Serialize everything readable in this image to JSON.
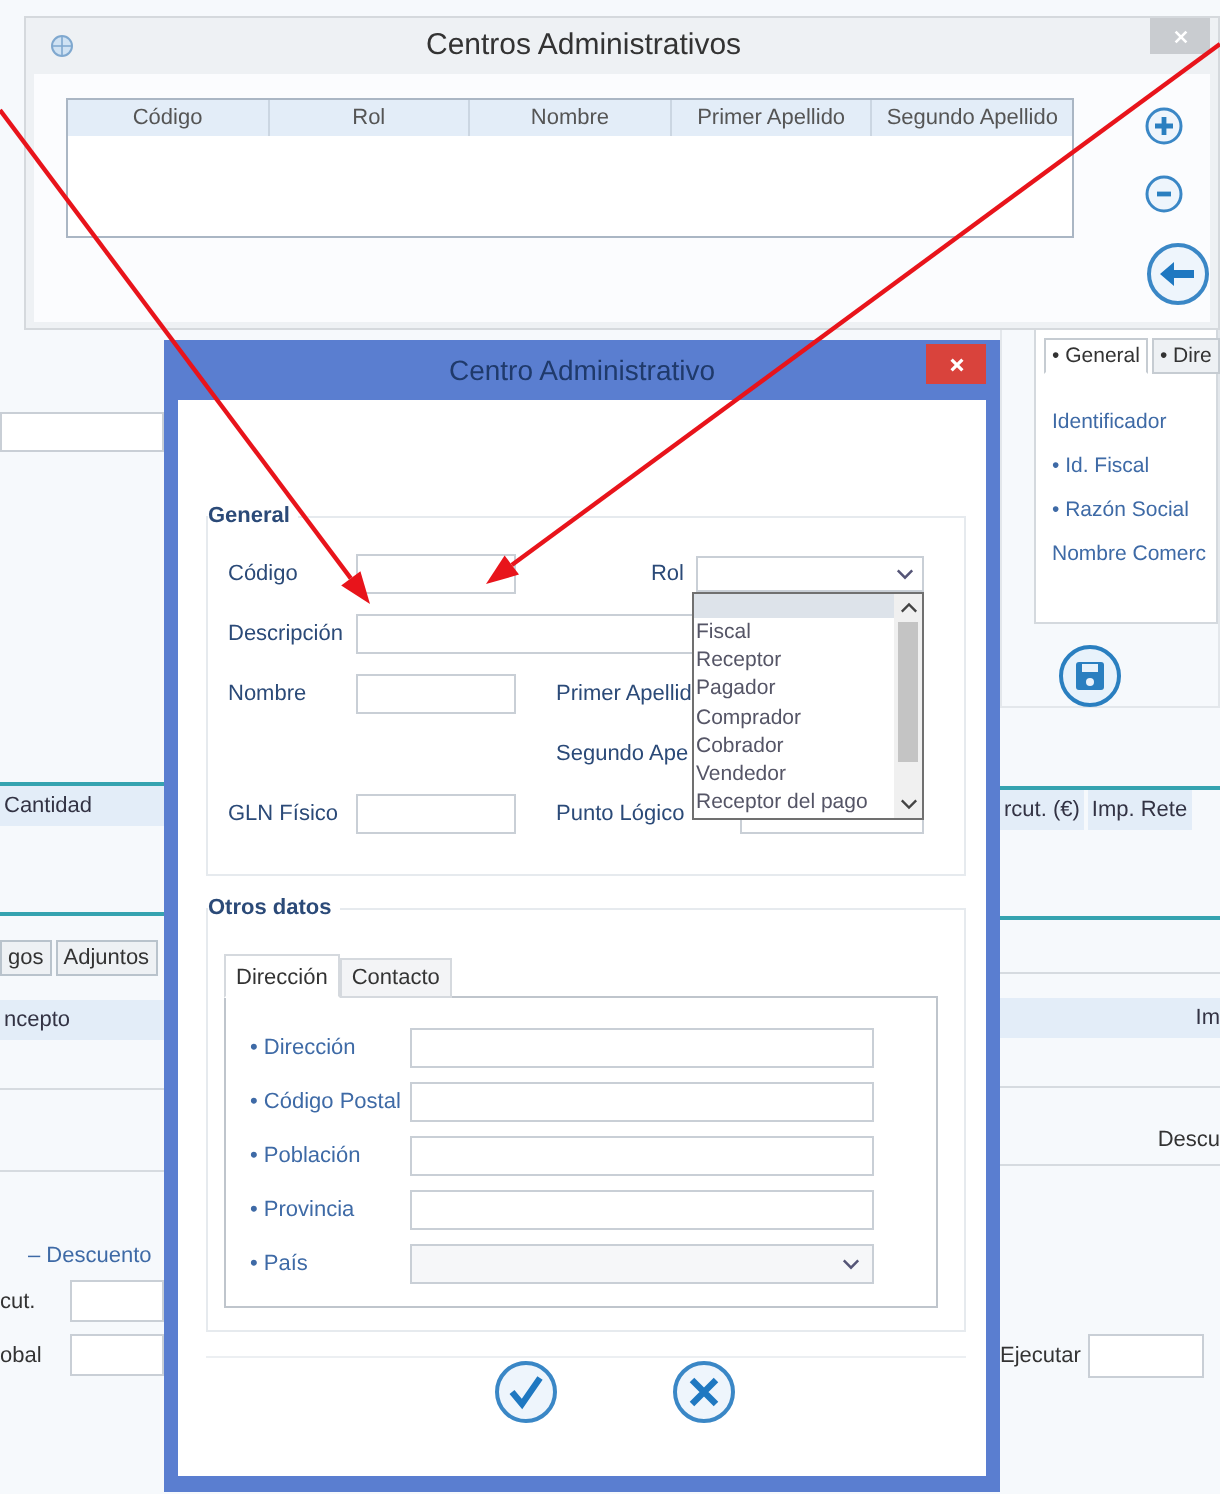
{
  "list_window": {
    "title": "Centros Administrativos",
    "columns": [
      "Código",
      "Rol",
      "Nombre",
      "Primer Apellido",
      "Segundo Apellido"
    ]
  },
  "background": {
    "right_panel": {
      "tabs": [
        {
          "label": "• General",
          "selected": true
        },
        {
          "label": "• Dire",
          "selected": false
        }
      ],
      "labels": [
        "Identificador",
        "• Id. Fiscal",
        "• Razón Social",
        "Nombre Comerc"
      ]
    },
    "lines_table": {
      "columns": [
        "Cantidad",
        "rcut. (€)",
        "Imp. Rete"
      ]
    },
    "tabs": [
      {
        "label": "gos",
        "selected": false
      },
      {
        "label": "Adjuntos",
        "selected": false
      }
    ],
    "concept_table": {
      "columns": [
        "ncepto",
        "Im"
      ]
    },
    "summary_label": "Descu",
    "discount_toggle": "– Descuento",
    "fields": [
      {
        "label": "cut."
      },
      {
        "label": "obal"
      }
    ],
    "execute_field": {
      "label": "Ejecutar"
    }
  },
  "dialog": {
    "title": "Centro Administrativo",
    "general": {
      "title": "General",
      "rows": [
        [
          {
            "label": "Código",
            "kind": "input"
          },
          {
            "label": "Rol",
            "kind": "select"
          }
        ],
        [
          {
            "label": "Descripción",
            "kind": "wide"
          }
        ],
        [
          {
            "label": "Nombre",
            "kind": "input"
          },
          {
            "label": "Primer Apellid",
            "kind": "label"
          }
        ],
        [
          {
            "kind": "spacer"
          },
          {
            "label": "Segundo Ape",
            "kind": "label"
          }
        ],
        [
          {
            "label": "GLN Físico",
            "kind": "input"
          },
          {
            "label": "Punto Lógico",
            "kind": "input"
          }
        ]
      ]
    },
    "role_dropdown": {
      "blank_option_highlighted": true,
      "options": [
        {
          "label": "Fiscal",
          "selected": false
        },
        {
          "label": "Receptor",
          "selected": false
        },
        {
          "label": "Pagador",
          "selected": false
        },
        {
          "label": "Comprador",
          "selected": false
        },
        {
          "label": "Cobrador",
          "selected": false
        },
        {
          "label": "Vendedor",
          "selected": false
        },
        {
          "label": "Receptor del pago",
          "selected": false
        }
      ]
    },
    "other": {
      "title": "Otros datos",
      "tabs": [
        {
          "label": "Dirección",
          "selected": true
        },
        {
          "label": "Contacto",
          "selected": false
        }
      ],
      "fields": [
        {
          "label": "• Dirección",
          "kind": "input"
        },
        {
          "label": "• Código Postal",
          "kind": "input"
        },
        {
          "label": "• Población",
          "kind": "input"
        },
        {
          "label": "• Provincia",
          "kind": "input"
        },
        {
          "label": "• País",
          "kind": "select"
        }
      ]
    }
  }
}
